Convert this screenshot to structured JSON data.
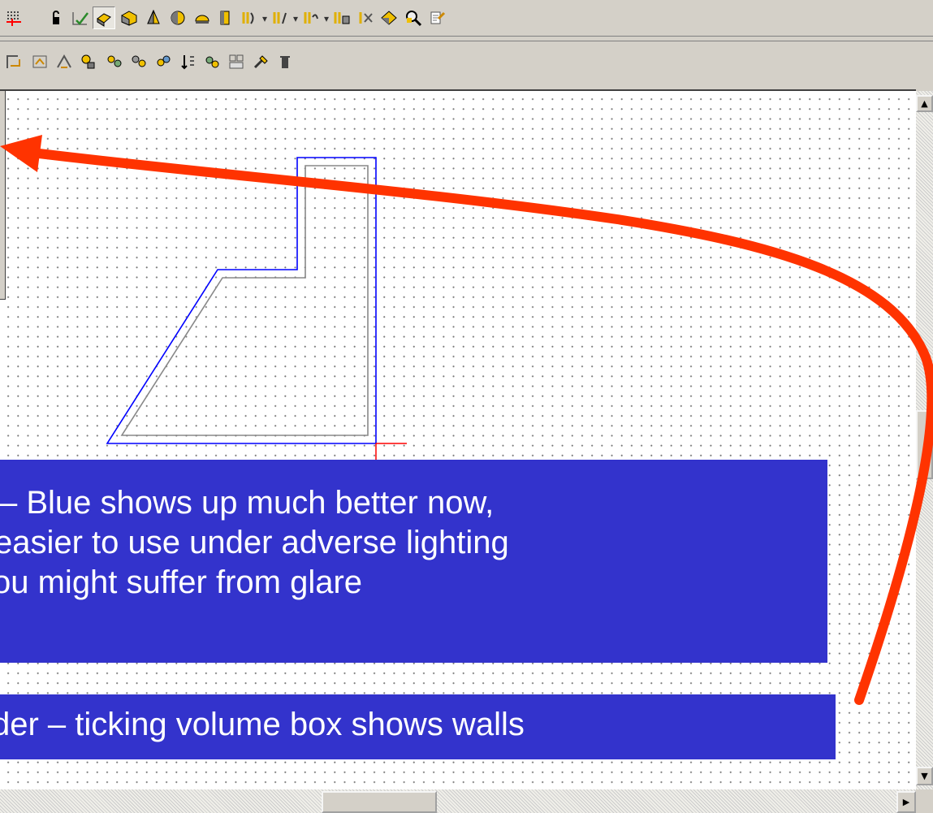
{
  "toolbar_row1": {
    "icons": [
      "grid-icon",
      "lock-icon",
      "checkmark-icon",
      "render-icon",
      "solid-icon",
      "cone-icon",
      "sphere-icon",
      "hemisphere-icon",
      "cylinder-icon",
      "extrude-icon",
      "revolve-icon",
      "sweep-icon",
      "boolean-icon",
      "cut-icon",
      "volume-icon",
      "inspect-icon",
      "properties-icon"
    ],
    "dropdown_glyph": "▾"
  },
  "toolbar_row2": {
    "icons": [
      "measure-icon",
      "dimension-icon",
      "angle-icon",
      "light-icon",
      "lights-icon",
      "lights-group-icon",
      "render-light-icon",
      "sort-icon",
      "texture-icon",
      "layout-icon",
      "paint-icon",
      "trash-icon"
    ]
  },
  "callouts": {
    "top_lines": [
      "– Blue shows up much better now,",
      "easier to use under adverse lighting",
      "ou might suffer from glare"
    ],
    "bottom": "der – ticking volume box shows walls"
  },
  "scrollbars": {
    "up_glyph": "▲",
    "down_glyph": "▼",
    "right_glyph": "▶"
  },
  "colors": {
    "callout_bg": "#3333cc",
    "arrow": "#ff3300",
    "outline_blue": "#0000ff",
    "outline_gray": "#808080",
    "cursor_red": "#ff0000"
  }
}
